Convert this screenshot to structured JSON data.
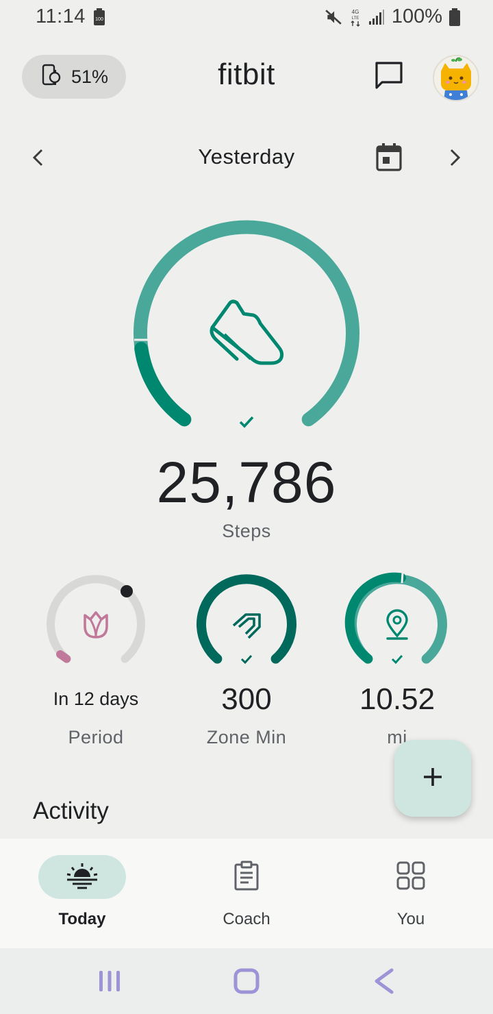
{
  "status_bar": {
    "time": "11:14",
    "battery_percent": "100%",
    "icons": [
      "battery-saver-icon",
      "mute-icon",
      "lte-icon",
      "signal-icon",
      "battery-icon"
    ]
  },
  "header": {
    "device_battery": "51%",
    "app_title": "fitbit",
    "icons": [
      "device-icon",
      "messages-icon",
      "avatar"
    ]
  },
  "date_nav": {
    "label": "Yesterday",
    "icons": [
      "chevron-left-icon",
      "calendar-icon",
      "chevron-right-icon"
    ]
  },
  "steps": {
    "value": "25,786",
    "label": "Steps",
    "goal_met": true,
    "ring_color": "#4aa89a",
    "ring_dark_color": "#00876f"
  },
  "metrics": [
    {
      "value": "In 12 days",
      "label": "Period",
      "icon": "tulip-icon",
      "color": "#c0799a"
    },
    {
      "value": "300",
      "label": "Zone Min",
      "icon": "zone-arrows-icon",
      "color": "#00695c",
      "goal_met": true
    },
    {
      "value": "10.52",
      "label": "mi",
      "icon": "location-pin-icon",
      "color": "#00876f",
      "goal_met": true
    }
  ],
  "fab": {
    "icon": "plus-icon"
  },
  "activity": {
    "title": "Activity"
  },
  "bottom_nav": {
    "items": [
      {
        "label": "Today",
        "icon": "sunrise-icon",
        "active": true
      },
      {
        "label": "Coach",
        "icon": "clipboard-icon",
        "active": false
      },
      {
        "label": "You",
        "icon": "grid-icon",
        "active": false
      }
    ]
  },
  "system_nav": {
    "icons": [
      "recents-icon",
      "home-icon",
      "back-icon"
    ]
  },
  "colors": {
    "background": "#eff0ee",
    "accent": "#4aa89a",
    "accent_dark": "#00876f",
    "period": "#c0799a",
    "pill_active": "#cfe6e0"
  }
}
